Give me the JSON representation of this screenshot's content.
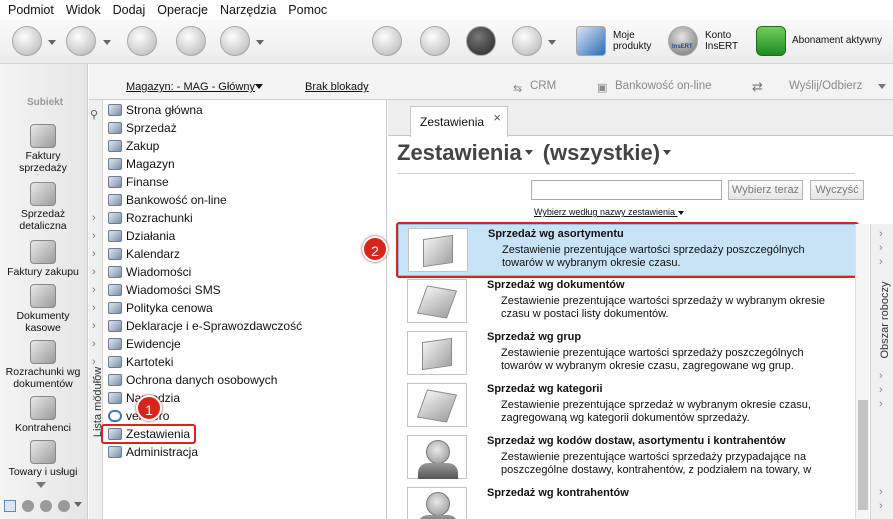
{
  "menu": [
    "Podmiot",
    "Widok",
    "Dodaj",
    "Operacje",
    "Narzędzia",
    "Pomoc"
  ],
  "toolbar": {
    "my_products": "Moje\nprodukty",
    "account": "Konto\nInsERT",
    "insert_logo": "InsERT",
    "subscription": "Abonament aktywny"
  },
  "leftbar": {
    "logo": "Subiekt",
    "modules": [
      "Faktury\nsprzedaży",
      "Sprzedaż\ndetaliczna",
      "Faktury zakupu",
      "Dokumenty\nkasowe",
      "Rozrachunki wg\ndokumentów",
      "Kontrahenci",
      "Towary i usługi"
    ]
  },
  "header": {
    "warehouse": "Magazyn: - MAG - Główny",
    "lock": "Brak blokady",
    "crm": "CRM",
    "bank": "Bankowość on-line",
    "send": "Wyślij/Odbierz"
  },
  "modules_panel": {
    "vertical_label": "Lista modułów",
    "items": [
      "Strona główna",
      "Sprzedaż",
      "Zakup",
      "Magazyn",
      "Finanse",
      "Bankowość on-line",
      "Rozrachunki",
      "Działania",
      "Kalendarz",
      "Wiadomości",
      "Wiadomości SMS",
      "Polityka cenowa",
      "Deklaracje i e-Sprawozdawczość",
      "Ewidencje",
      "Kartoteki",
      "Ochrona danych osobowych",
      "Narzędzia",
      "vendero",
      "Zestawienia",
      "Administracja"
    ]
  },
  "tab": {
    "label": "Zestawienia",
    "close": "×"
  },
  "content": {
    "title": "Zestawienia",
    "filter": "(wszystkie)",
    "search_placeholder": "",
    "choose_button": "Wybierz teraz",
    "clear_button": "Wyczyść",
    "sort_label": "Wybierz według nazwy zestawienia",
    "reports": [
      {
        "name": "Sprzedaż wg asortymentu",
        "desc": "Zestawienie prezentujące wartości sprzedaży poszczególnych towarów w wybranym okresie czasu.",
        "icon": "box"
      },
      {
        "name": "Sprzedaż wg dokumentów",
        "desc": "Zestawienie prezentujące wartości sprzedaży w wybranym okresie czasu w postaci listy dokumentów.",
        "icon": "stack"
      },
      {
        "name": "Sprzedaż wg grup",
        "desc": "Zestawienie prezentujące wartości sprzedaży poszczególnych towarów w wybranym okresie czasu, zagregowane wg grup.",
        "icon": "box"
      },
      {
        "name": "Sprzedaż wg kategorii",
        "desc": "Zestawienie prezentujące sprzedaż w wybranym okresie czasu, zagregowaną wg kategorii dokumentów sprzedaży.",
        "icon": "stack"
      },
      {
        "name": "Sprzedaż wg kodów dostaw, asortymentu i kontrahentów",
        "desc": "Zestawienie prezentujące wartości sprzedaży przypadające na poszczególne dostawy, kontrahentów, z podziałem na towary, w",
        "icon": "person"
      },
      {
        "name": "Sprzedaż wg kontrahentów",
        "desc": "",
        "icon": "person"
      }
    ]
  },
  "work_area": {
    "label": "Obszar roboczy"
  },
  "annotations": {
    "one": "1",
    "two": "2"
  }
}
